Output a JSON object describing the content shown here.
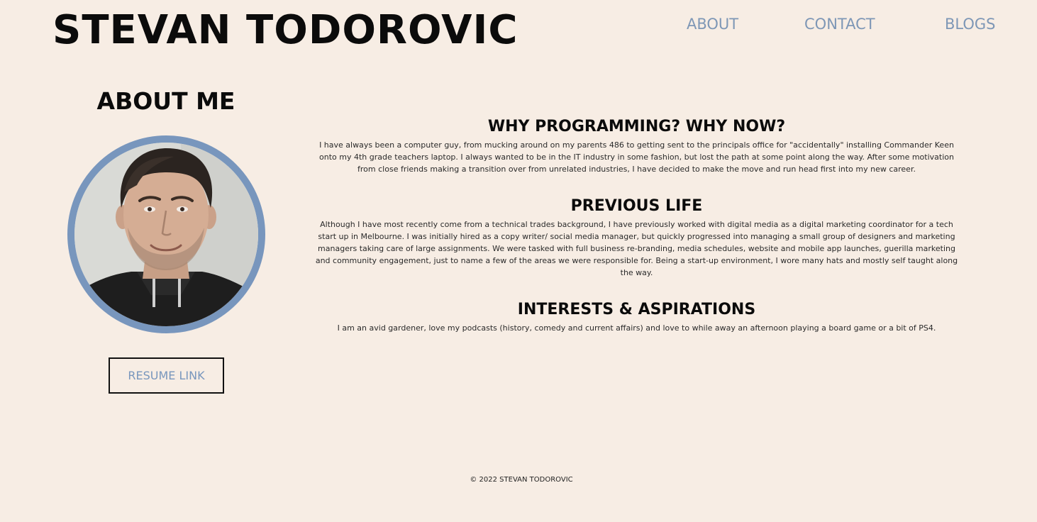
{
  "header": {
    "site_title": "STEVAN TODOROVIC",
    "nav": {
      "about": "ABOUT",
      "contact": "CONTACT",
      "blogs": "BLOGS"
    }
  },
  "sidebar": {
    "heading": "ABOUT ME",
    "resume_label": "RESUME LINK"
  },
  "sections": {
    "why": {
      "title": "WHY PROGRAMMING? WHY NOW?",
      "body": "I have always been a computer guy, from mucking around on my parents 486 to getting sent to the principals office for \"accidentally\" installing Commander Keen onto my 4th grade teachers laptop. I always wanted to be in the IT industry in some fashion, but lost the path at some point along the way. After some motivation from close friends making a transition over from unrelated industries, I have decided to make the move and run head first into my new career."
    },
    "previous": {
      "title": "PREVIOUS LIFE",
      "body": "Although I have most recently come from a technical trades background, I have previously worked with digital media as a digital marketing coordinator for a tech start up in Melbourne. I was initially hired as a copy writer/ social media manager, but quickly progressed into managing a small group of designers and marketing managers taking care of large assignments. We were tasked with full business re-branding, media schedules, website and mobile app launches, guerilla marketing and community engagement, just to name a few of the areas we were responsible for. Being a start-up environment, I wore many hats and mostly self taught along the way."
    },
    "interests": {
      "title": "INTERESTS & ASPIRATIONS",
      "body": "I am an avid gardener, love my podcasts (history, comedy and current affairs) and love to while away an afternoon playing a board game or a bit of PS4."
    }
  },
  "footer": {
    "copyright": "© 2022 STEVAN TODOROVIC"
  },
  "colors": {
    "background": "#f7ede4",
    "accent": "#7896bd",
    "nav_text": "#7e97b6",
    "text": "#0b0b0b"
  }
}
